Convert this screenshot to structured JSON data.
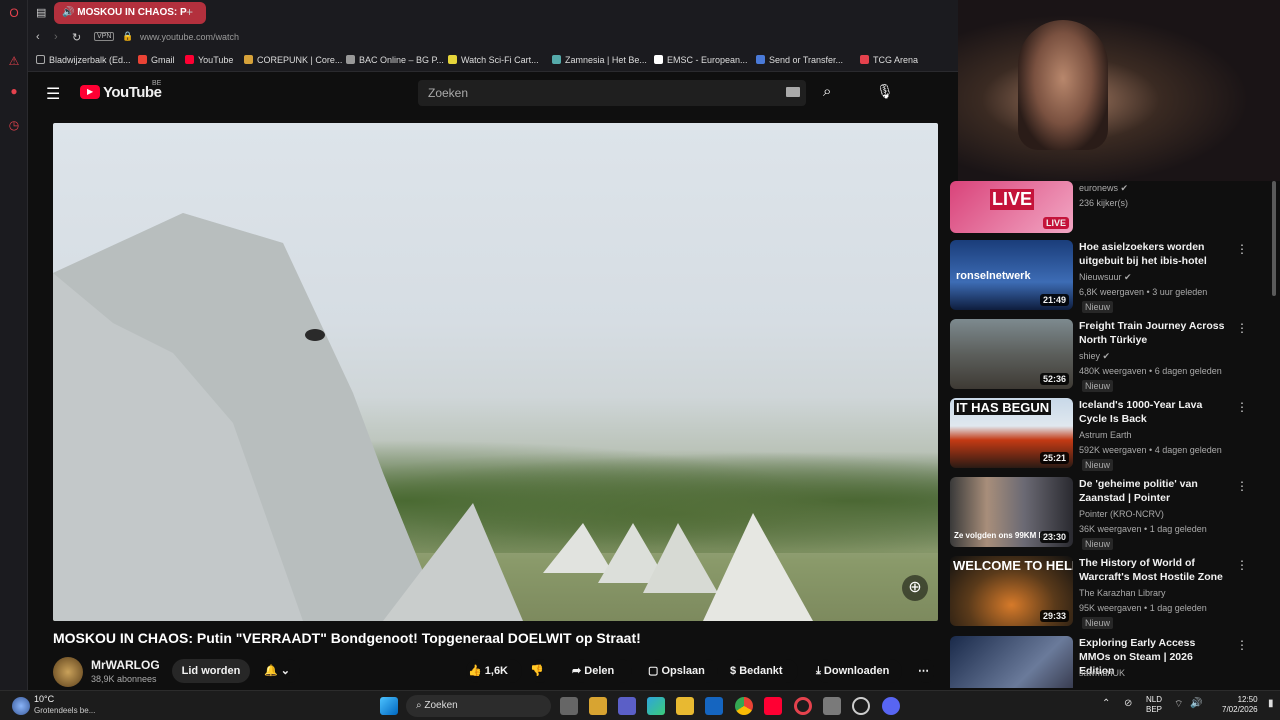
{
  "browser": {
    "tab_title": "MOSKOU IN CHAOS: P",
    "vpn": "VPN",
    "url": "www.youtube.com/watch",
    "bookmarks": [
      "Bladwijzerbalk (Ed...",
      "Gmail",
      "YouTube",
      "COREPUNK | Core...",
      "BAC Online – BG P...",
      "Watch Sci-Fi Cart...",
      "Zamnesia | Het Be...",
      "EMSC - European...",
      "Send or Transfer...",
      "TCG Arena"
    ]
  },
  "youtube": {
    "logo": "YouTube",
    "region": "BE",
    "search_placeholder": "Zoeken"
  },
  "video": {
    "title": "MOSKOU IN CHAOS: Putin \"VERRAADT\" Bondgenoot! Topgeneraal DOELWIT op Straat!",
    "channel": "MrWARLOG",
    "subscribers": "38,9K abonnees",
    "join": "Lid worden",
    "likes": "1,6K",
    "share": "Delen",
    "save": "Opslaan",
    "thanks": "Bedankt",
    "download": "Downloaden"
  },
  "sidebar": [
    {
      "title": "",
      "channel": "euronews",
      "views": "236 kijker(s)",
      "duration": "LIVE",
      "thumb_text": "LIVE",
      "new": ""
    },
    {
      "title": "Hoe asielzoekers worden uitgebuit bij het ibis-hotel",
      "channel": "Nieuwsuur",
      "views": "6,8K weergaven • 3 uur geleden",
      "duration": "21:49",
      "thumb_text": "ronselnetwerk",
      "new": "Nieuw"
    },
    {
      "title": "Freight Train Journey Across North Türkiye",
      "channel": "shiey",
      "views": "480K weergaven • 6 dagen geleden",
      "duration": "52:36",
      "thumb_text": "",
      "new": "Nieuw"
    },
    {
      "title": "Iceland's 1000-Year Lava Cycle Is Back",
      "channel": "Astrum Earth",
      "views": "592K weergaven • 4 dagen geleden",
      "duration": "25:21",
      "thumb_text": "IT HAS BEGUN",
      "new": "Nieuw"
    },
    {
      "title": "De 'geheime politie' van Zaanstad | Pointer",
      "channel": "Pointer (KRO-NCRV)",
      "views": "36K weergaven • 1 dag geleden",
      "duration": "23:30",
      "thumb_text": "Ze volgden ons 99KM lang",
      "new": "Nieuw"
    },
    {
      "title": "The History of World of Warcraft's Most Hostile Zone",
      "channel": "The Karazhan Library",
      "views": "95K weergaven • 1 dag geleden",
      "duration": "29:33",
      "thumb_text": "WELCOME TO HELL",
      "new": "Nieuw"
    },
    {
      "title": "Exploring Early Access MMOs on Steam | 2026 Edition",
      "channel": "sawmanUK",
      "views": "",
      "duration": "",
      "thumb_text": "",
      "new": ""
    }
  ],
  "taskbar": {
    "temp": "10°C",
    "weather": "Grotendeels be...",
    "search": "Zoeken",
    "lang1": "NLD",
    "lang2": "BEP",
    "time": "12:50",
    "date": "7/02/2026"
  },
  "colors": {
    "accent": "#ff0033",
    "opera": "#e5424d",
    "tab": "#b3303d"
  }
}
